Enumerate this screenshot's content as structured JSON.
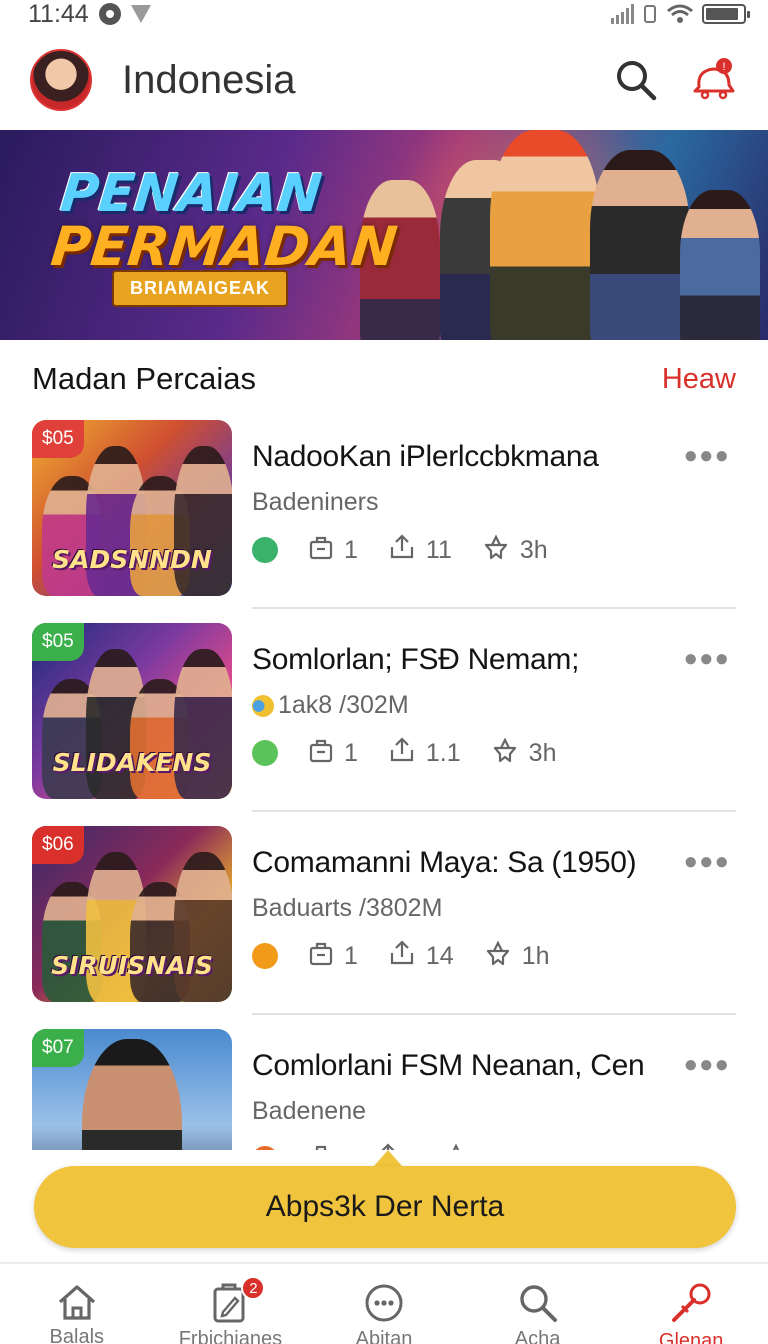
{
  "status_bar": {
    "time": "11:44",
    "battery_level": 0.9
  },
  "header": {
    "title": "Indonesia",
    "icons": [
      "search-icon",
      "notification-icon"
    ],
    "notification_badge": "!"
  },
  "banner": {
    "title_line1": "PENAIAN",
    "title_line2": "PERMADAN",
    "subtitle": "BRIAMAIGEAK"
  },
  "section": {
    "title": "Madan Percaias",
    "link_label": "Heaw"
  },
  "items": [
    {
      "price": "$05",
      "price_color": "#e0403a",
      "thumb_logo": "SADSNNDN",
      "title": "NadooKan iPlerlccbkmana",
      "subtitle": "Badeniners",
      "status_color": "#3bb26b",
      "stat1": "1",
      "stat2": "11",
      "stat3": "3h"
    },
    {
      "price": "$05",
      "price_color": "#3bb04a",
      "thumb_logo": "SLIDAKENS",
      "title": "Somlorlan; FSĐ Nemam;",
      "subtitle": "1ak8 /302M",
      "status_color": "#5cc35a",
      "stat1": "1",
      "stat2": "1.1",
      "stat3": "3h"
    },
    {
      "price": "$06",
      "price_color": "#d9302b",
      "thumb_logo": "SIRUISNAIS",
      "title": "Comamanni Maya: Sa (1950)",
      "subtitle": "Baduarts /3802M",
      "status_color": "#f29a1a",
      "stat1": "1",
      "stat2": "14",
      "stat3": "1h"
    },
    {
      "price": "$07",
      "price_color": "#3bb04a",
      "thumb_logo": "",
      "title": "Comlorlani FSM Neanan, Cen",
      "subtitle": "Badenene",
      "status_color": "#e86a2a",
      "stat1": "",
      "stat2": "",
      "stat3": ""
    }
  ],
  "cta": {
    "label": "Abps3k Der Nerta"
  },
  "bottom_nav": [
    {
      "label": "Balals",
      "icon": "home-icon",
      "active": false
    },
    {
      "label": "Frbichianes",
      "icon": "edit-clipboard-icon",
      "badge": "2",
      "active": false
    },
    {
      "label": "Abitan",
      "icon": "chat-bubble-icon",
      "active": false
    },
    {
      "label": "Acha",
      "icon": "search-icon",
      "active": false
    },
    {
      "label": "Glenan",
      "icon": "microphone-icon",
      "active": true
    }
  ],
  "colors": {
    "accent": "#d9302b",
    "cta": "#f0c43c",
    "text": "#141414",
    "muted": "#666666"
  }
}
